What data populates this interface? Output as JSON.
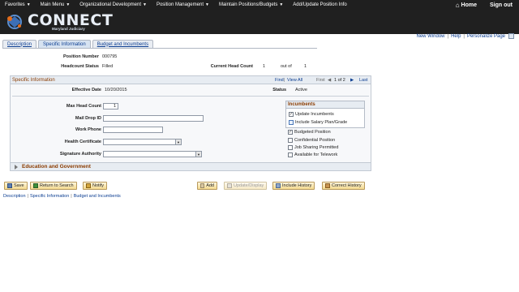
{
  "nav": {
    "items": [
      "Favorites",
      "Main Menu",
      "Organizational Development",
      "Position Management",
      "Maintain Positions/Budgets",
      "Add/Update Position Info"
    ],
    "home": "Home",
    "signout": "Sign out"
  },
  "logo": {
    "word": "CONNECT",
    "sub": "Maryland Judiciary"
  },
  "actions": {
    "new_window": "New Window",
    "help": "Help",
    "personalize": "Personalize Page"
  },
  "tabs": [
    "Description",
    "Specific Information",
    "Budget and Incumbents"
  ],
  "header": {
    "position_number_label": "Position Number",
    "position_number": "000795",
    "headcount_status_label": "Headcount Status",
    "headcount_status": "Filled",
    "current_head_count_label": "Current Head Count",
    "current_head_count": "1",
    "out_of_label": "out of",
    "out_of": "1"
  },
  "section": {
    "title": "Specific Information",
    "find": "Find",
    "view_all": "View All",
    "first": "First",
    "page_info": "1 of 2",
    "last": "Last",
    "effective_date_label": "Effective Date",
    "effective_date": "10/20/2015",
    "status_label": "Status",
    "status": "Active"
  },
  "form": {
    "max_head_count_label": "Max Head Count",
    "max_head_count": "1",
    "mail_drop_label": "Mail Drop ID",
    "work_phone_label": "Work Phone",
    "health_cert_label": "Health Certificate",
    "signature_label": "Signature Authority"
  },
  "incumbents": {
    "title": "Incumbents",
    "update_incumbents": "Update Incumbents",
    "include_salary": "Include Salary Plan/Grade"
  },
  "flags": {
    "budgeted": "Budgeted Position",
    "confidential": "Confidential Position",
    "job_sharing": "Job Sharing Permitted",
    "telework": "Available for Telework"
  },
  "collapse": {
    "title": "Education and Government"
  },
  "buttons": {
    "save": "Save",
    "return_search": "Return to Search",
    "notify": "Notify",
    "add": "Add",
    "update_display": "Update/Display",
    "include_history": "Include History",
    "correct_history": "Correct History"
  },
  "bottom_links": [
    "Description",
    "Specific Information",
    "Budget and Incumbents"
  ]
}
